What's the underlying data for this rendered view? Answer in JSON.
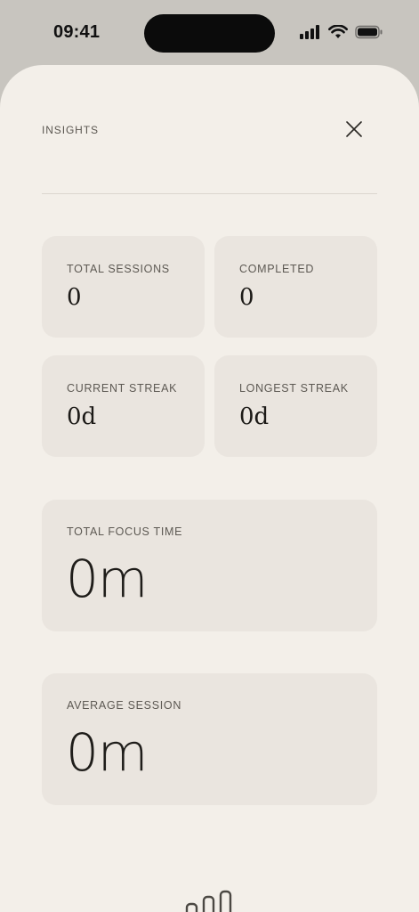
{
  "status_bar": {
    "time": "09:41"
  },
  "header": {
    "title": "INSIGHTS",
    "close_icon": "close-icon"
  },
  "stats_grid": [
    {
      "label": "TOTAL SESSIONS",
      "value": "0"
    },
    {
      "label": "COMPLETED",
      "value": "0"
    },
    {
      "label": "CURRENT STREAK",
      "value": "0d"
    },
    {
      "label": "LONGEST STREAK",
      "value": "0d"
    }
  ],
  "total_focus": {
    "label": "TOTAL FOCUS TIME",
    "value": "0m"
  },
  "average_session": {
    "label": "AVERAGE SESSION",
    "value": "0m"
  },
  "colors": {
    "sheet_bg": "#f3efe9",
    "card_bg": "#eae5df",
    "outer_bg": "#c8c5bf"
  },
  "footer_icon": "bar-chart-icon"
}
